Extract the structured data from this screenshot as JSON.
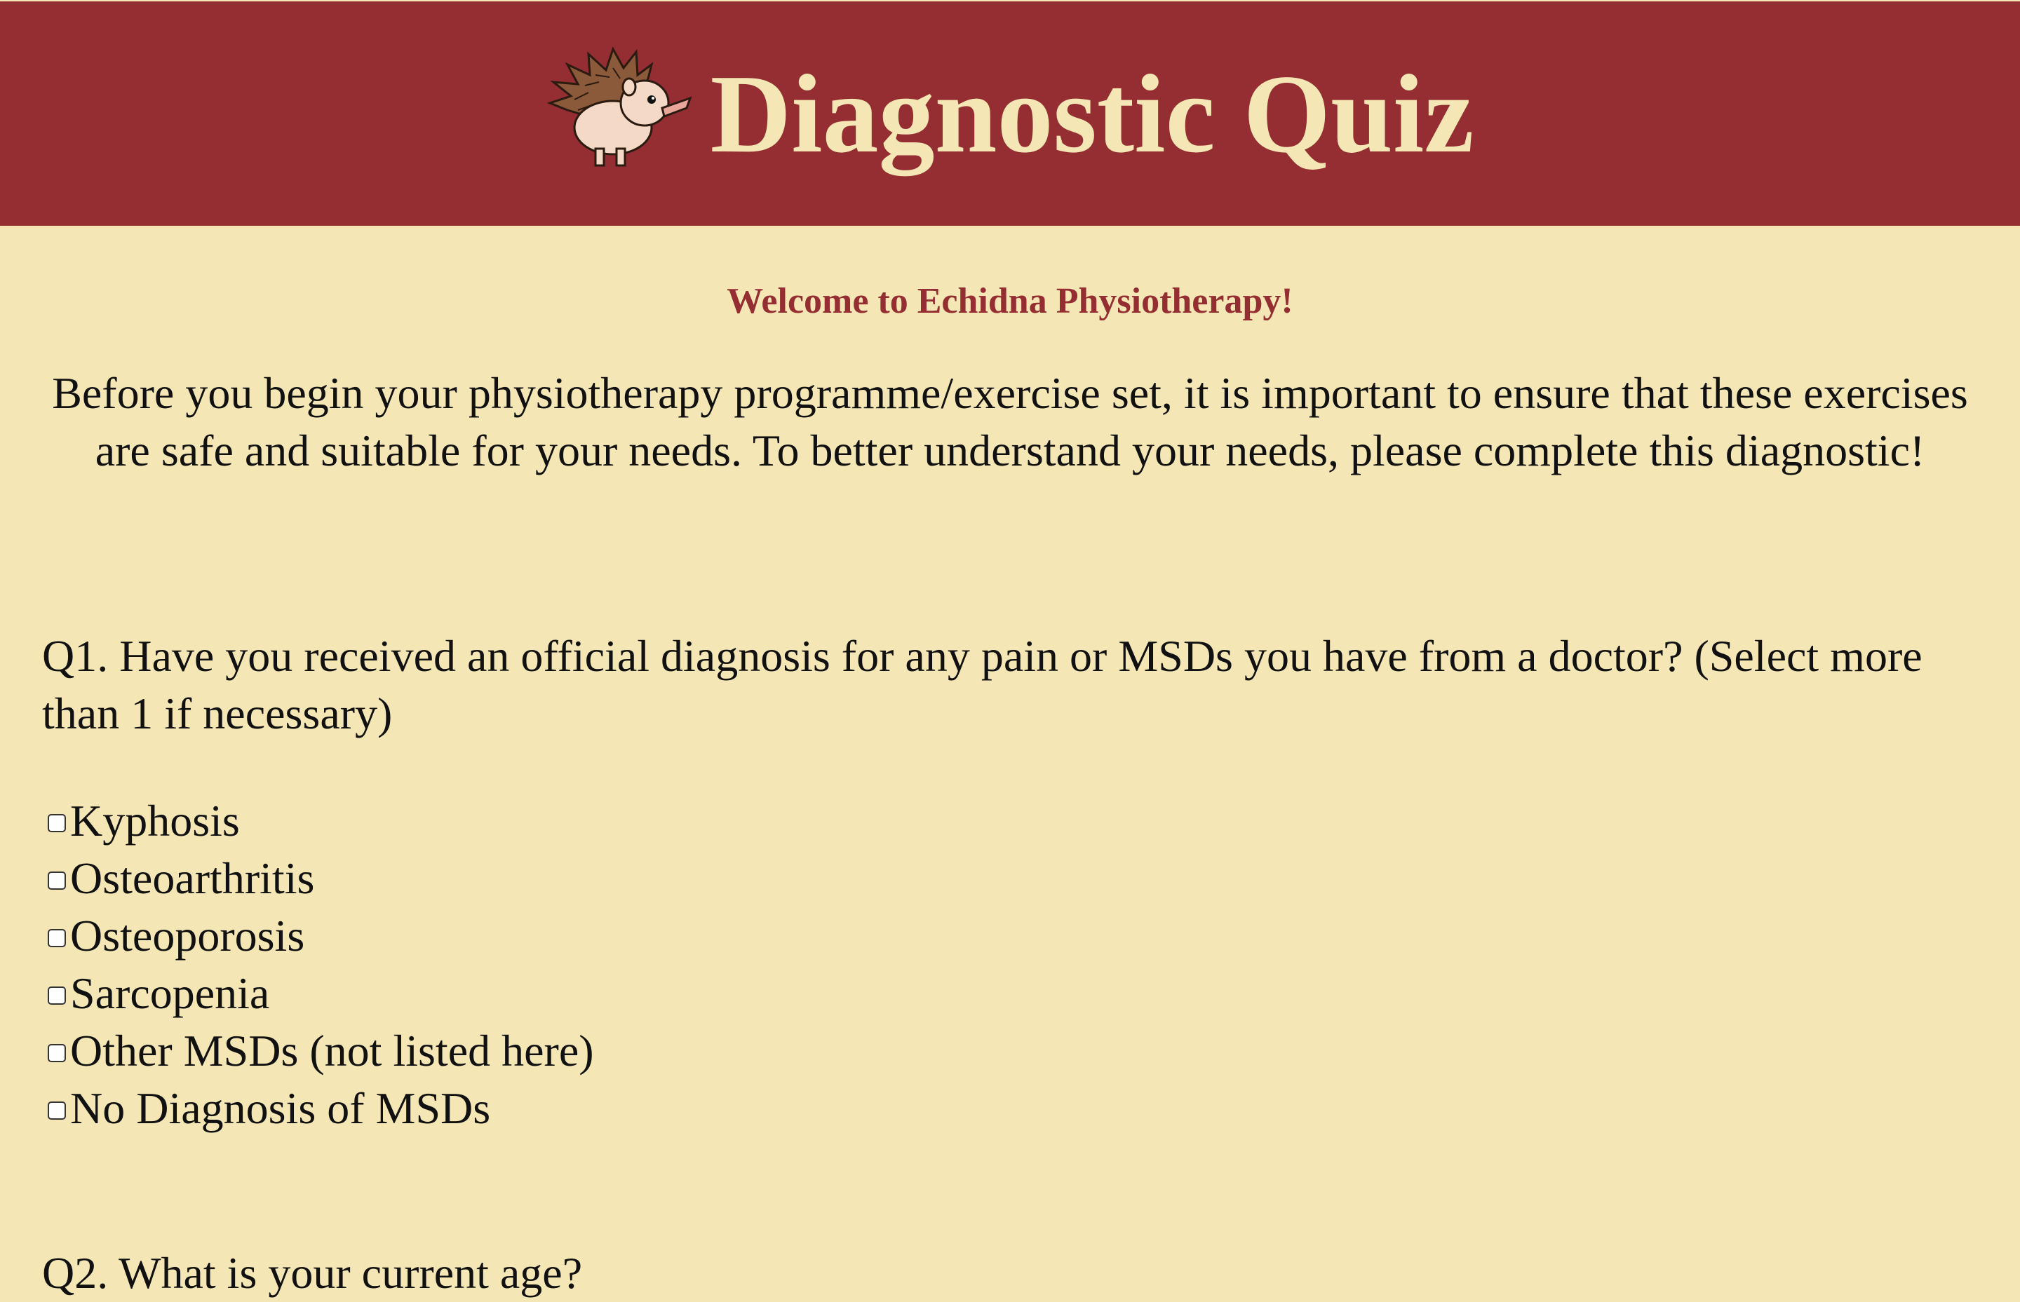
{
  "header": {
    "title": "Diagnostic Quiz",
    "logo_icon": "echidna-icon",
    "background_color": "#942E32",
    "title_color": "#F5E7B5"
  },
  "welcome": "Welcome to Echidna Physiotherapy!",
  "intro": "Before you begin your physiotherapy programme/exercise set, it is important to ensure that these exercises are safe and suitable for your needs. To better understand your needs, please complete this diagnostic!",
  "questions": [
    {
      "text": "Q1. Have you received an official diagnosis for any pain or MSDs you have from a doctor? (Select more than 1 if necessary)",
      "options": [
        {
          "label": "Kyphosis",
          "checked": false
        },
        {
          "label": "Osteoarthritis",
          "checked": false
        },
        {
          "label": "Osteoporosis",
          "checked": false
        },
        {
          "label": "Sarcopenia",
          "checked": false
        },
        {
          "label": "Other MSDs (not listed here)",
          "checked": false
        },
        {
          "label": "No Diagnosis of MSDs",
          "checked": false
        }
      ]
    },
    {
      "text": "Q2. What is your current age?"
    }
  ],
  "page_background": "#F5E7B5"
}
